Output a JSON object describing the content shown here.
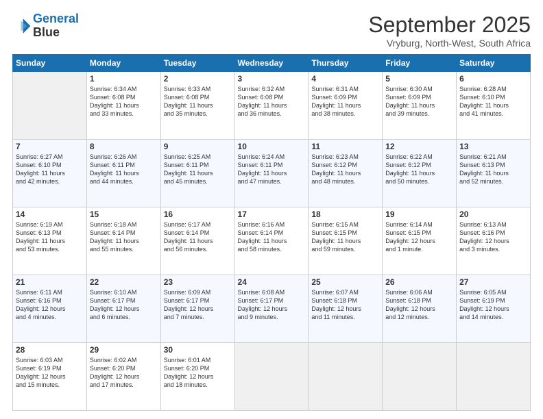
{
  "logo": {
    "line1": "General",
    "line2": "Blue"
  },
  "title": "September 2025",
  "subtitle": "Vryburg, North-West, South Africa",
  "weekdays": [
    "Sunday",
    "Monday",
    "Tuesday",
    "Wednesday",
    "Thursday",
    "Friday",
    "Saturday"
  ],
  "weeks": [
    [
      {
        "day": "",
        "info": ""
      },
      {
        "day": "1",
        "info": "Sunrise: 6:34 AM\nSunset: 6:08 PM\nDaylight: 11 hours\nand 33 minutes."
      },
      {
        "day": "2",
        "info": "Sunrise: 6:33 AM\nSunset: 6:08 PM\nDaylight: 11 hours\nand 35 minutes."
      },
      {
        "day": "3",
        "info": "Sunrise: 6:32 AM\nSunset: 6:08 PM\nDaylight: 11 hours\nand 36 minutes."
      },
      {
        "day": "4",
        "info": "Sunrise: 6:31 AM\nSunset: 6:09 PM\nDaylight: 11 hours\nand 38 minutes."
      },
      {
        "day": "5",
        "info": "Sunrise: 6:30 AM\nSunset: 6:09 PM\nDaylight: 11 hours\nand 39 minutes."
      },
      {
        "day": "6",
        "info": "Sunrise: 6:28 AM\nSunset: 6:10 PM\nDaylight: 11 hours\nand 41 minutes."
      }
    ],
    [
      {
        "day": "7",
        "info": "Sunrise: 6:27 AM\nSunset: 6:10 PM\nDaylight: 11 hours\nand 42 minutes."
      },
      {
        "day": "8",
        "info": "Sunrise: 6:26 AM\nSunset: 6:11 PM\nDaylight: 11 hours\nand 44 minutes."
      },
      {
        "day": "9",
        "info": "Sunrise: 6:25 AM\nSunset: 6:11 PM\nDaylight: 11 hours\nand 45 minutes."
      },
      {
        "day": "10",
        "info": "Sunrise: 6:24 AM\nSunset: 6:11 PM\nDaylight: 11 hours\nand 47 minutes."
      },
      {
        "day": "11",
        "info": "Sunrise: 6:23 AM\nSunset: 6:12 PM\nDaylight: 11 hours\nand 48 minutes."
      },
      {
        "day": "12",
        "info": "Sunrise: 6:22 AM\nSunset: 6:12 PM\nDaylight: 11 hours\nand 50 minutes."
      },
      {
        "day": "13",
        "info": "Sunrise: 6:21 AM\nSunset: 6:13 PM\nDaylight: 11 hours\nand 52 minutes."
      }
    ],
    [
      {
        "day": "14",
        "info": "Sunrise: 6:19 AM\nSunset: 6:13 PM\nDaylight: 11 hours\nand 53 minutes."
      },
      {
        "day": "15",
        "info": "Sunrise: 6:18 AM\nSunset: 6:14 PM\nDaylight: 11 hours\nand 55 minutes."
      },
      {
        "day": "16",
        "info": "Sunrise: 6:17 AM\nSunset: 6:14 PM\nDaylight: 11 hours\nand 56 minutes."
      },
      {
        "day": "17",
        "info": "Sunrise: 6:16 AM\nSunset: 6:14 PM\nDaylight: 11 hours\nand 58 minutes."
      },
      {
        "day": "18",
        "info": "Sunrise: 6:15 AM\nSunset: 6:15 PM\nDaylight: 11 hours\nand 59 minutes."
      },
      {
        "day": "19",
        "info": "Sunrise: 6:14 AM\nSunset: 6:15 PM\nDaylight: 12 hours\nand 1 minute."
      },
      {
        "day": "20",
        "info": "Sunrise: 6:13 AM\nSunset: 6:16 PM\nDaylight: 12 hours\nand 3 minutes."
      }
    ],
    [
      {
        "day": "21",
        "info": "Sunrise: 6:11 AM\nSunset: 6:16 PM\nDaylight: 12 hours\nand 4 minutes."
      },
      {
        "day": "22",
        "info": "Sunrise: 6:10 AM\nSunset: 6:17 PM\nDaylight: 12 hours\nand 6 minutes."
      },
      {
        "day": "23",
        "info": "Sunrise: 6:09 AM\nSunset: 6:17 PM\nDaylight: 12 hours\nand 7 minutes."
      },
      {
        "day": "24",
        "info": "Sunrise: 6:08 AM\nSunset: 6:17 PM\nDaylight: 12 hours\nand 9 minutes."
      },
      {
        "day": "25",
        "info": "Sunrise: 6:07 AM\nSunset: 6:18 PM\nDaylight: 12 hours\nand 11 minutes."
      },
      {
        "day": "26",
        "info": "Sunrise: 6:06 AM\nSunset: 6:18 PM\nDaylight: 12 hours\nand 12 minutes."
      },
      {
        "day": "27",
        "info": "Sunrise: 6:05 AM\nSunset: 6:19 PM\nDaylight: 12 hours\nand 14 minutes."
      }
    ],
    [
      {
        "day": "28",
        "info": "Sunrise: 6:03 AM\nSunset: 6:19 PM\nDaylight: 12 hours\nand 15 minutes."
      },
      {
        "day": "29",
        "info": "Sunrise: 6:02 AM\nSunset: 6:20 PM\nDaylight: 12 hours\nand 17 minutes."
      },
      {
        "day": "30",
        "info": "Sunrise: 6:01 AM\nSunset: 6:20 PM\nDaylight: 12 hours\nand 18 minutes."
      },
      {
        "day": "",
        "info": ""
      },
      {
        "day": "",
        "info": ""
      },
      {
        "day": "",
        "info": ""
      },
      {
        "day": "",
        "info": ""
      }
    ]
  ]
}
